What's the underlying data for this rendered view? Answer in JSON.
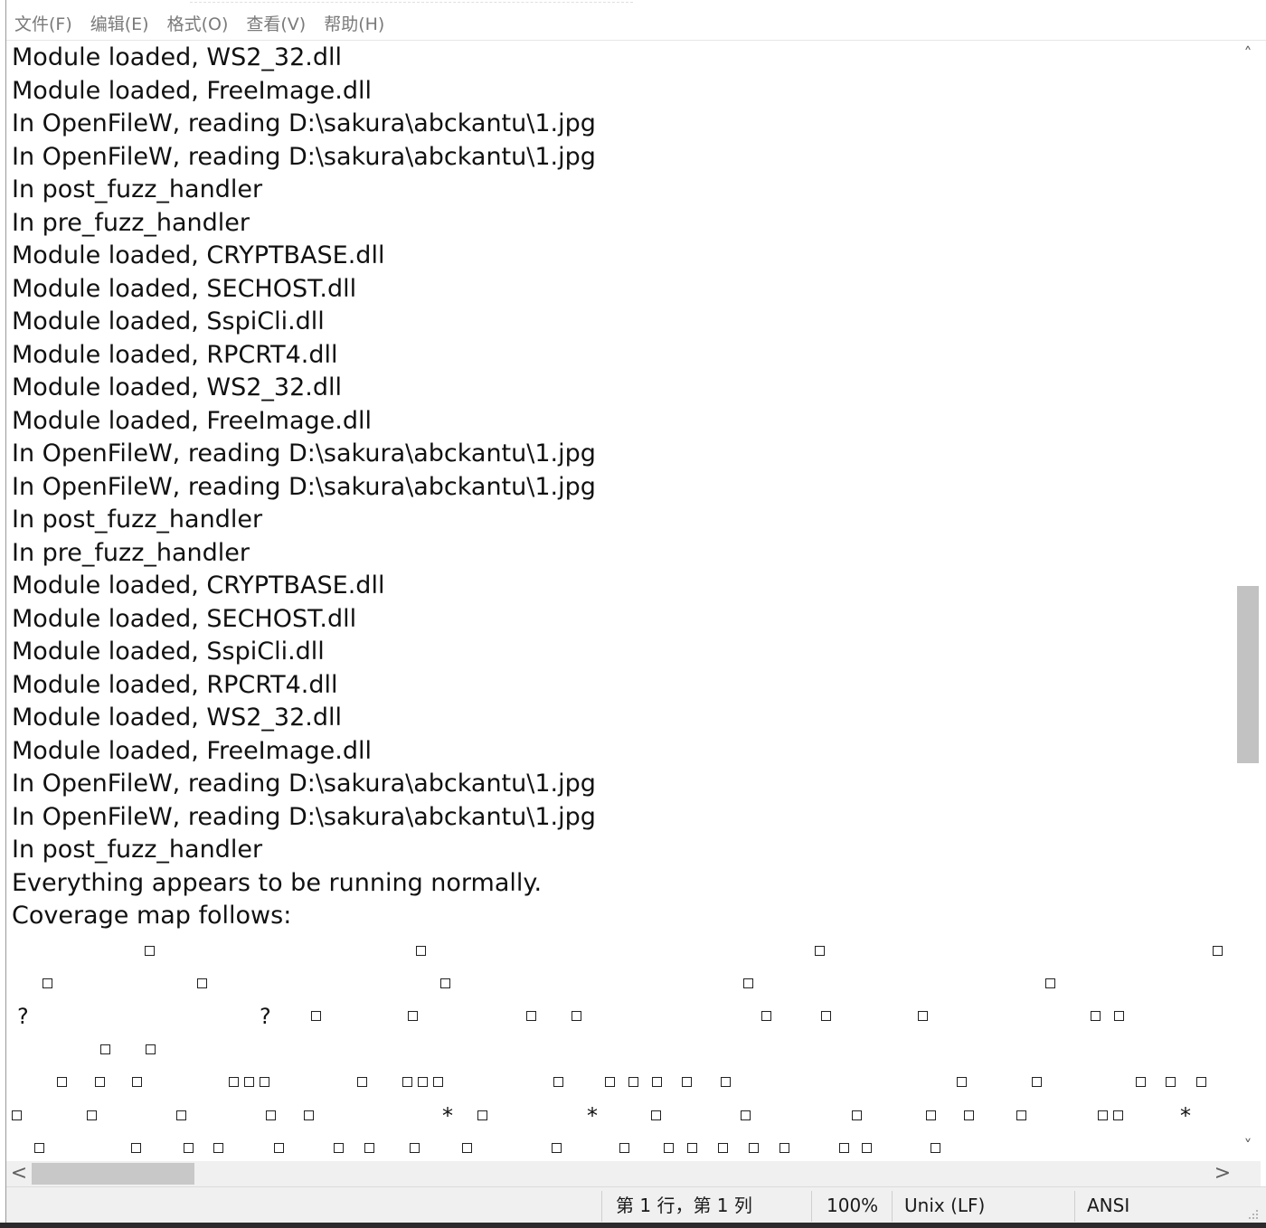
{
  "menu": {
    "items": [
      "文件(F)",
      "编辑(E)",
      "格式(O)",
      "查看(V)",
      "帮助(H)"
    ]
  },
  "editor": {
    "lines": [
      "Module loaded, WS2_32.dll",
      "Module loaded, FreeImage.dll",
      "In OpenFileW, reading D:\\sakura\\abckantu\\1.jpg",
      "In OpenFileW, reading D:\\sakura\\abckantu\\1.jpg",
      "In post_fuzz_handler",
      "In pre_fuzz_handler",
      "Module loaded, CRYPTBASE.dll",
      "Module loaded, SECHOST.dll",
      "Module loaded, SspiCli.dll",
      "Module loaded, RPCRT4.dll",
      "Module loaded, WS2_32.dll",
      "Module loaded, FreeImage.dll",
      "In OpenFileW, reading D:\\sakura\\abckantu\\1.jpg",
      "In OpenFileW, reading D:\\sakura\\abckantu\\1.jpg",
      "In post_fuzz_handler",
      "In pre_fuzz_handler",
      "Module loaded, CRYPTBASE.dll",
      "Module loaded, SECHOST.dll",
      "Module loaded, SspiCli.dll",
      "Module loaded, RPCRT4.dll",
      "Module loaded, WS2_32.dll",
      "Module loaded, FreeImage.dll",
      "In OpenFileW, reading D:\\sakura\\abckantu\\1.jpg",
      "In OpenFileW, reading D:\\sakura\\abckantu\\1.jpg",
      "In post_fuzz_handler",
      "Everything appears to be running normally.",
      "Coverage map follows:"
    ],
    "coverage_glyphs": [
      "?",
      "?",
      "*",
      "*",
      "*"
    ]
  },
  "scrollbars": {
    "up_arrow": "˄",
    "down_arrow": "˅",
    "left_arrow": "<",
    "right_arrow": ">"
  },
  "status": {
    "position": "第 1 行，第 1 列",
    "zoom": "100%",
    "line_ending": "Unix (LF)",
    "encoding": "ANSI"
  }
}
